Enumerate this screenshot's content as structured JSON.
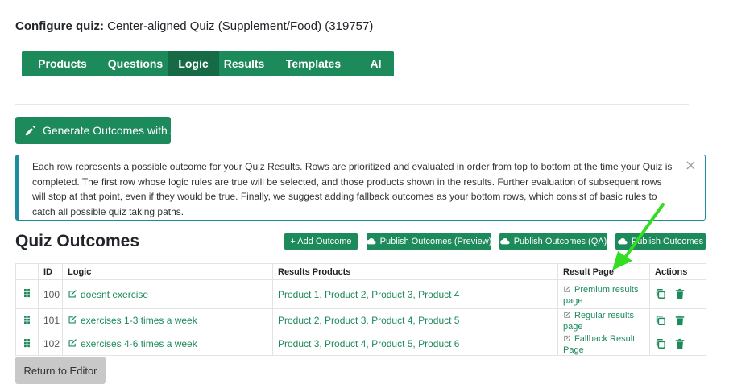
{
  "config": {
    "label": "Configure quiz:",
    "quiz_name": "Center-aligned Quiz (Supplement/Food) (319757)"
  },
  "nav": {
    "tabs": [
      {
        "label": "Products",
        "active": false
      },
      {
        "label": "Questions",
        "active": false
      },
      {
        "label": "Logic",
        "active": true
      },
      {
        "label": "Results",
        "active": false
      },
      {
        "label": "Templates",
        "active": false
      },
      {
        "label": "AI",
        "active": false
      }
    ]
  },
  "generate_button": "Generate Outcomes with AI",
  "alert": {
    "text": "Each row represents a possible outcome for your Quiz Results. Rows are prioritized and evaluated in order from top to bottom at the time your Quiz is completed. The first row whose logic rules are true will be selected, and those products shown in the results. Further evaluation of subsequent rows will stop at that point, even if they would be true. Finally, we suggest adding fallback outcomes as your bottom rows, which consist of basic rules to catch all possible quiz taking paths.",
    "close": "×"
  },
  "outcomes": {
    "title": "Quiz Outcomes",
    "buttons": {
      "add": "+ Add Outcome",
      "publish_preview": "Publish Outcomes (Preview)",
      "publish_qa": "Publish Outcomes (QA)",
      "publish": "Publish Outcomes"
    },
    "columns": [
      "ID",
      "Logic",
      "Results Products",
      "Result Page",
      "Actions"
    ],
    "rows": [
      {
        "id": "100",
        "logic": "doesnt exercise",
        "products": "Product 1, Product 2, Product 3, Product 4",
        "result_page": "Premium results page"
      },
      {
        "id": "101",
        "logic": "exercises 1-3 times a week",
        "products": "Product 2, Product 3, Product 4, Product 5",
        "result_page": "Regular results page"
      },
      {
        "id": "102",
        "logic": "exercises 4-6 times a week",
        "products": "Product 3, Product 4, Product 5, Product 6",
        "result_page": "Fallback Result Page"
      }
    ]
  },
  "return_button": "Return to Editor",
  "colors": {
    "brand_green": "#1d8a5b",
    "active_tab": "#166b46",
    "alert_border": "#1d8a9e",
    "annotation_arrow": "#33dd22"
  }
}
